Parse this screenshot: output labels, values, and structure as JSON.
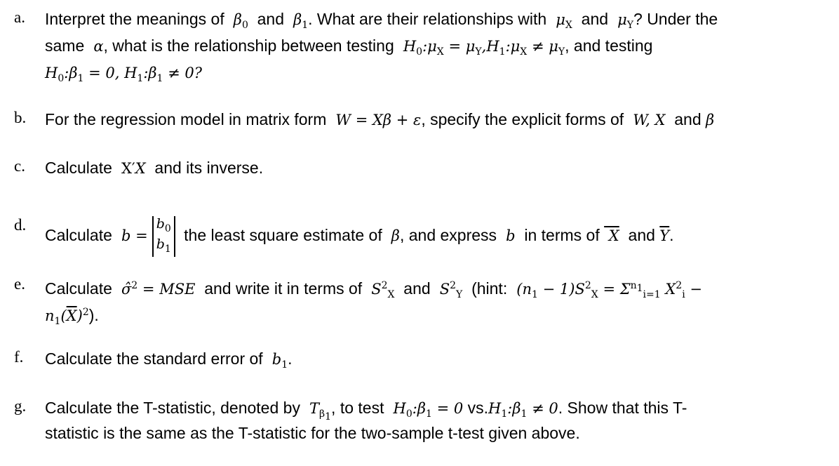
{
  "questions": [
    {
      "label": "a.",
      "lines": [
        "Interpret the meanings of β₀ and β₁. What are their relationships with μX and μY? Under the",
        "same α, what is the relationship between testing H₀: μX = μY, H₁: μX ≠ μY, and testing",
        "H₀: β₁ = 0, H₁: β₁ ≠ 0?"
      ]
    },
    {
      "label": "b.",
      "lines": [
        "For the regression model in matrix form W = Xβ + ε, specify the explicit forms of W, X and β"
      ]
    },
    {
      "label": "c.",
      "lines": [
        "Calculate X′X and its inverse."
      ]
    },
    {
      "label": "d.",
      "lines": [
        "Calculate b = [b₀; b₁] the least square estimate of β, and express b in terms of X̄ and Ȳ."
      ]
    },
    {
      "label": "e.",
      "lines": [
        "Calculate σ̂² = MSE and write it in terms of S²X and S²Y (hint: (n₁ − 1)S²X = Σ_{i=1}^{n₁} X²ᵢ −",
        "n₁(X̄)²)."
      ]
    },
    {
      "label": "f.",
      "lines": [
        "Calculate the standard error of b₁."
      ]
    },
    {
      "label": "g.",
      "lines": [
        "Calculate the T-statistic, denoted by T_β₁, to test H₀: β₁ = 0 vs. H₁: β₁ ≠ 0. Show that this T-",
        "statistic is the same as the T-statistic for the two-sample t-test given above."
      ]
    }
  ],
  "text": {
    "a1": "Interpret the meanings of",
    "and": "and",
    "a1b": ". What are their relationships with",
    "a1c": "? Under the",
    "a2a": "same",
    "a2b": ", what is the relationship between testing",
    "a2c": ", and testing",
    "b1": "For the regression model in matrix form",
    "b1b": ", specify the explicit forms of",
    "c1": "Calculate",
    "c1b": "and its inverse.",
    "d1": "Calculate",
    "d1b": "the least square estimate of",
    "d1c": ", and express",
    "d1d": "in terms of",
    "e1": "Calculate",
    "e1b": "and write it in terms of",
    "e1c": "(hint:",
    "f1": "Calculate the standard error of",
    "g1": "Calculate the T-statistic, denoted by",
    "g1b": ", to test",
    "g1c": "vs.",
    "g1d": ". Show that this T-",
    "g2": "statistic is the same as the T-statistic for the two-sample t-test given above."
  }
}
